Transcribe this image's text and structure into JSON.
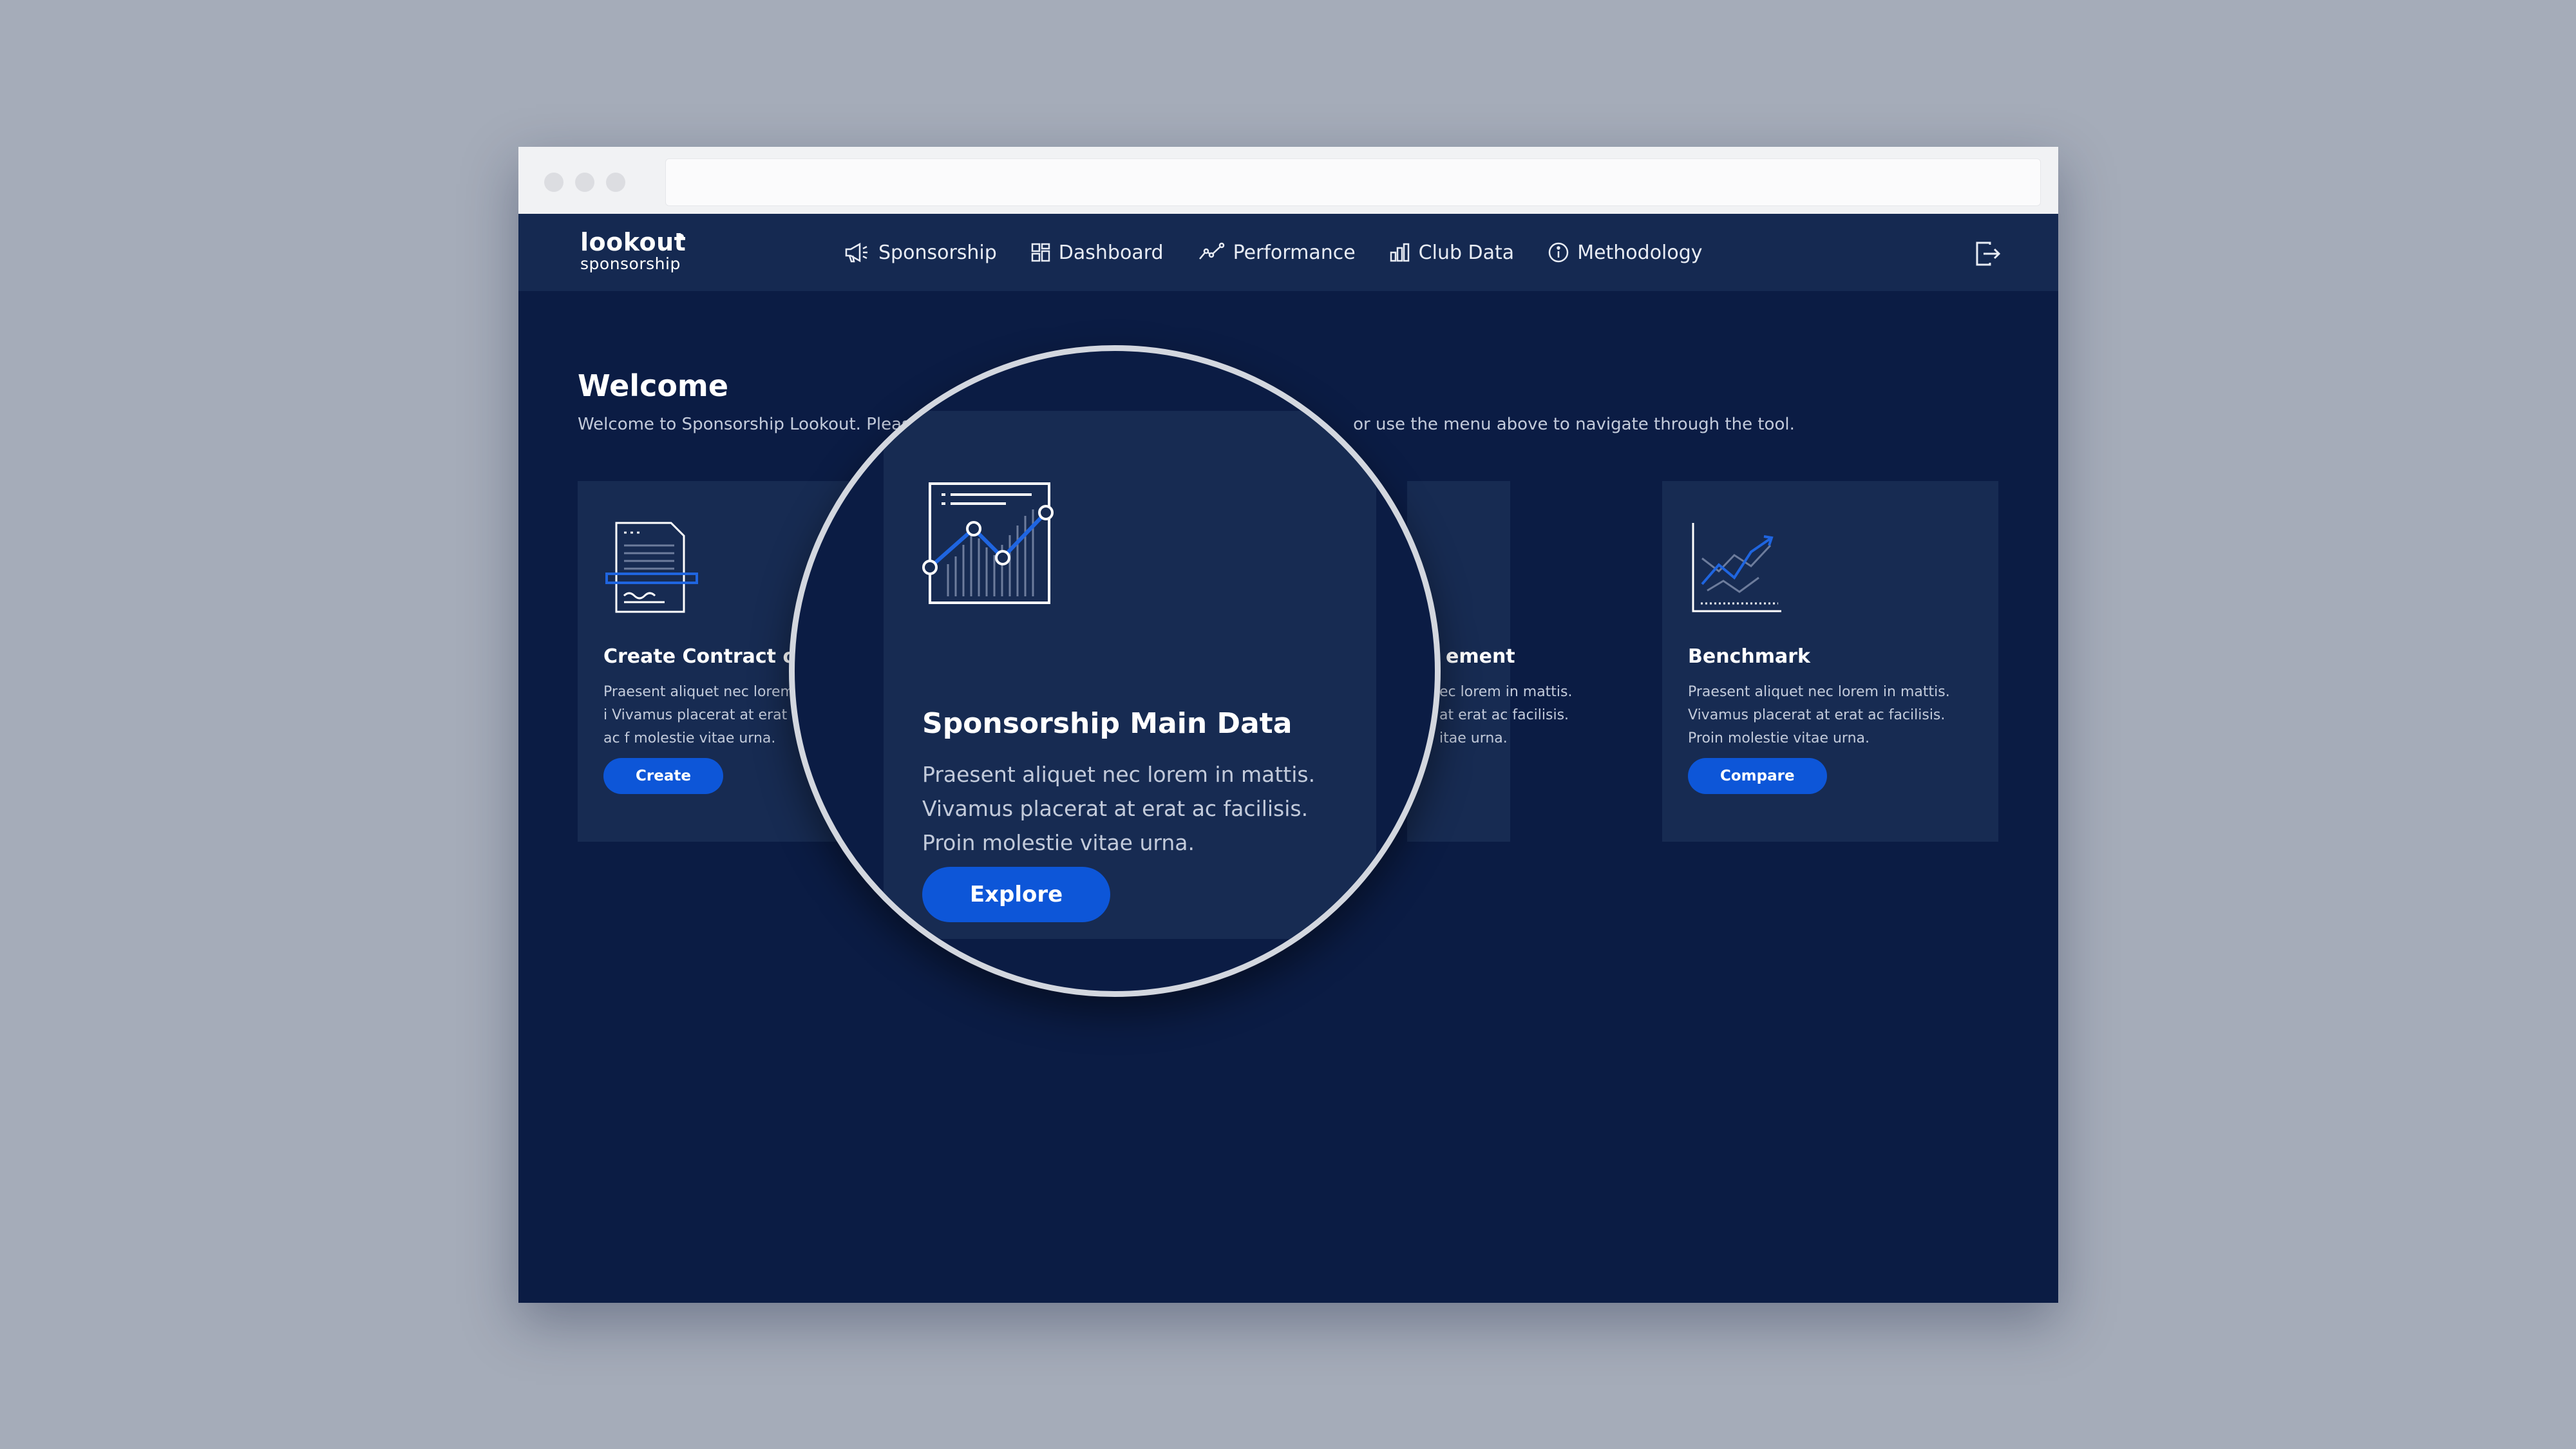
{
  "logo": {
    "main": "lookout",
    "sub": "sponsorship"
  },
  "nav": [
    {
      "label": "Sponsorship",
      "icon": "megaphone-icon"
    },
    {
      "label": "Dashboard",
      "icon": "grid-icon"
    },
    {
      "label": "Performance",
      "icon": "trend-line-icon"
    },
    {
      "label": "Club Data",
      "icon": "bar-chart-icon"
    },
    {
      "label": "Methodology",
      "icon": "info-icon"
    }
  ],
  "logout_icon": "logout-icon",
  "welcome": {
    "title": "Welcome",
    "text_left": "Welcome to Sponsorship Lookout. Please",
    "text_right": "or use the menu above to navigate through the tool."
  },
  "cards": [
    {
      "title": "Create Contract or P",
      "desc": "Praesent aliquet nec lorem i Vivamus placerat at erat ac f molestie vitae urna.",
      "button": "Create",
      "icon": "contract-document-icon"
    },
    {
      "title": "ement",
      "desc": "ec lorem in mattis. at erat ac facilisis. itae urna.",
      "icon": "document-icon"
    },
    {
      "title": "Benchmark",
      "desc": "Praesent aliquet nec lorem in mattis. Vivamus placerat at erat ac facilisis. Proin molestie vitae urna.",
      "button": "Compare",
      "icon": "benchmark-chart-icon"
    }
  ],
  "magnified_card": {
    "title": "Sponsorship Main Data",
    "desc": "Praesent aliquet nec lorem in mattis. Vivamus placerat at erat ac facilisis. Proin molestie vitae urna.",
    "button": "Explore",
    "icon": "line-chart-icon"
  },
  "colors": {
    "page_bg": "#a5acb9",
    "app_bg": "#0b1c44",
    "navbar": "#152951",
    "card": "#172b52",
    "accent": "#0d56d8",
    "text_muted": "#c3cbdb"
  }
}
